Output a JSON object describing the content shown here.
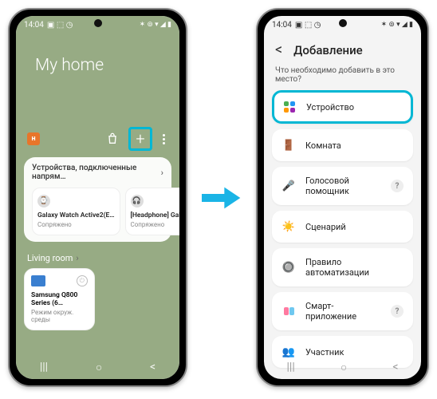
{
  "status": {
    "time": "14:04",
    "icons": "◧ ⬚ ⏲",
    "right": "⋮ ⊶ ▾ ◢ ▮"
  },
  "home": {
    "title": "My home",
    "badge": "н",
    "section1": {
      "title": "Устройства, подключенные напрям…",
      "devices": [
        {
          "name": "Galaxy Watch Active2(E…",
          "status": "Сопряжено"
        },
        {
          "name": "[Headphone] Galaxy Bud…",
          "status": "Сопряжено"
        }
      ]
    },
    "room": {
      "label": "Living room",
      "tile": {
        "name": "Samsung Q800 Series (6…",
        "status": "Режим окруж. среды"
      }
    }
  },
  "add": {
    "title": "Добавление",
    "question": "Что необходимо добавить в это место?",
    "items": [
      {
        "label": "Устройство"
      },
      {
        "label": "Комната"
      },
      {
        "label": "Голосовой помощник",
        "help": true
      },
      {
        "label": "Сценарий"
      },
      {
        "label": "Правило автоматизации"
      },
      {
        "label": "Смарт-приложение",
        "help": true
      },
      {
        "label": "Участник"
      }
    ]
  },
  "nav": {
    "recent": "|||",
    "home_btn": "○",
    "back": "<"
  }
}
